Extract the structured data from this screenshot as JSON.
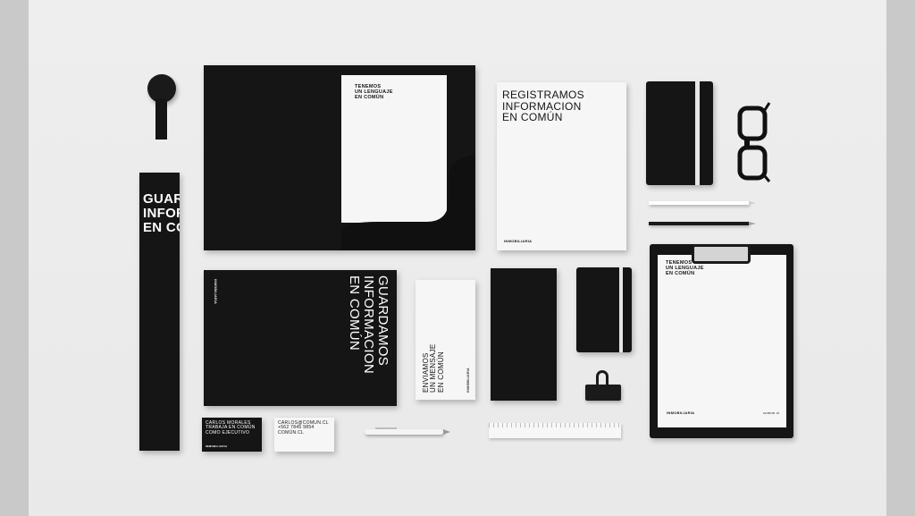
{
  "folder": {
    "insert_text": "TENEMOS\nUN LENGUAJE\nEN COMÚN"
  },
  "letterhead": {
    "headline": "REGISTRAMOS\nINFORMACION\nEN COMÚN",
    "footer": "INMOBILIARIA"
  },
  "tube": {
    "text": "GUARDAMOS\nINFORMACION\nEN COMÚN"
  },
  "black_folder": {
    "headline": "GUARDAMOS\nINFORMACION\nEN COMÚN",
    "spine_text": "INMOBILIARIA"
  },
  "envelope_white": {
    "text": "ENVIAMOS\nUN MENSAJE\nEN COMÚN",
    "small": "INMOBILIARIA"
  },
  "business_card_front": {
    "text": "CARLOS MORALES\nTRABAJA EN COMÚN\nCOMO EJECUTIVO",
    "small": "INMOBILIARIA"
  },
  "business_card_back": {
    "text": "CARLOS@COMUN.CL\n+562 7845 9854\nCOMÚN.CL"
  },
  "clipboard": {
    "text": "TENEMOS\nUN LENGUAJE\nEN COMÚN",
    "footer_left": "INMOBILIARIA",
    "footer_right": "comun.cl"
  }
}
